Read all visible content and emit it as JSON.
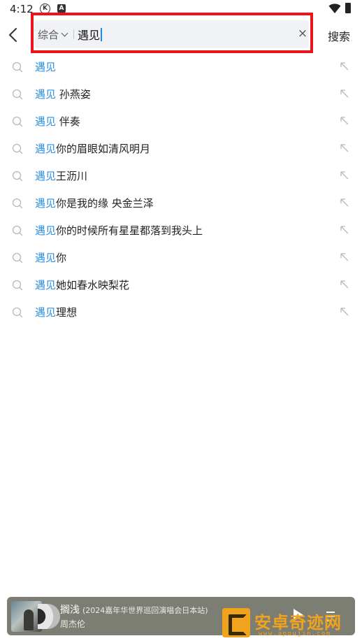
{
  "status_bar": {
    "time": "4:12",
    "k_badge": "K",
    "a_badge": "A"
  },
  "search": {
    "scope_label": "综合",
    "query": "遇见",
    "clear_symbol": "×",
    "submit_label": "搜索"
  },
  "suggestions": [
    {
      "highlight": "遇见",
      "rest": ""
    },
    {
      "highlight": "遇见",
      "rest": " 孙燕姿"
    },
    {
      "highlight": "遇见",
      "rest": " 伴奏"
    },
    {
      "highlight": "遇见",
      "rest": "你的眉眼如清风明月"
    },
    {
      "highlight": "遇见",
      "rest": "王沥川"
    },
    {
      "highlight": "遇见",
      "rest": "你是我的缘 央金兰泽"
    },
    {
      "highlight": "遇见",
      "rest": "你的时候所有星星都落到我头上"
    },
    {
      "highlight": "遇见",
      "rest": "你"
    },
    {
      "highlight": "遇见",
      "rest": "她如春水映梨花"
    },
    {
      "highlight": "遇见",
      "rest": "理想"
    }
  ],
  "player": {
    "title": "搁浅",
    "subtitle": "(2024嘉年华世界巡回演唱会日本站)",
    "artist": "周杰伦"
  },
  "watermark": {
    "title": "安卓奇迹网",
    "url": "www.apoujin.com"
  },
  "colors": {
    "highlight": "#2b90e6",
    "annotation_frame": "#e9141c",
    "player_bg": "#7d7e73",
    "watermark": "#f0a31c"
  }
}
